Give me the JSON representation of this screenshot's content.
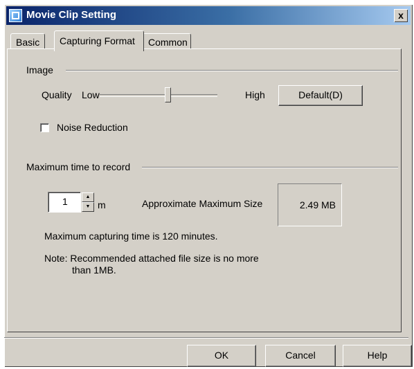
{
  "window": {
    "title": "Movie Clip Setting",
    "close_label": "x"
  },
  "tabs": [
    {
      "label": "Basic"
    },
    {
      "label": "Capturing Format",
      "active": true
    },
    {
      "label": "Common"
    }
  ],
  "image_group": {
    "title": "Image",
    "quality_label": "Quality",
    "low_label": "Low",
    "high_label": "High",
    "quality_value_fraction": 0.58,
    "default_button": "Default(D)",
    "noise_reduction_label": "Noise Reduction",
    "noise_reduction_checked": false
  },
  "record_group": {
    "title": "Maximum time to record",
    "minutes_value": "1",
    "minutes_unit": "m",
    "approx_size_label": "Approximate Maximum Size",
    "approx_size_value": "2.49 MB",
    "max_time_note": "Maximum capturing time is 120 minutes.",
    "note_line1": "Note: Recommended attached file size is no more",
    "note_line2": "than 1MB."
  },
  "footer": {
    "ok_label": "OK",
    "cancel_label": "Cancel",
    "help_label": "Help"
  }
}
